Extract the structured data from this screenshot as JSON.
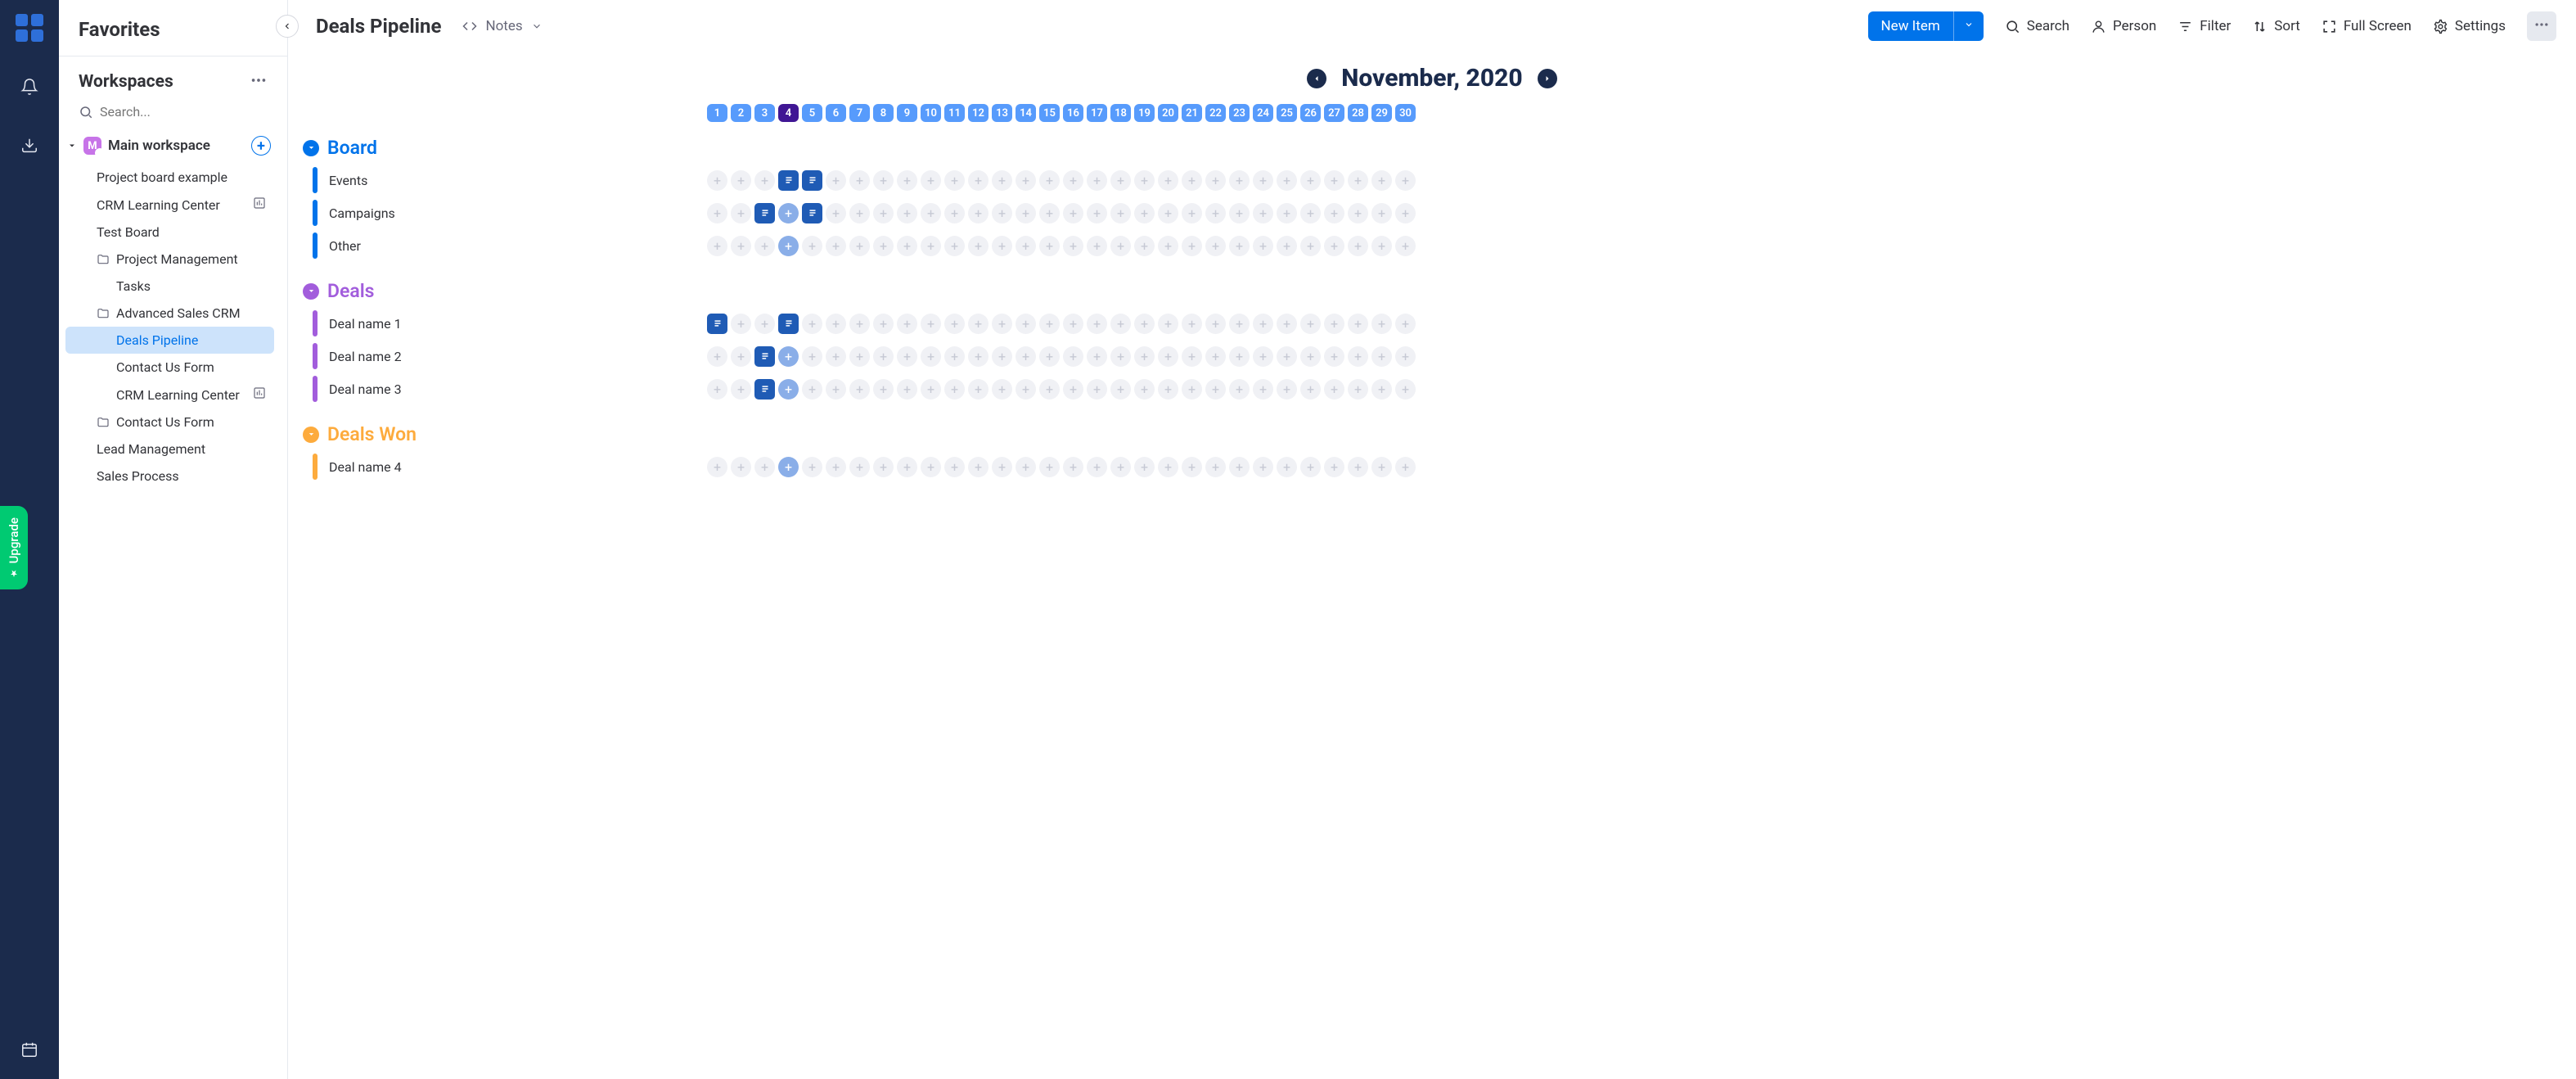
{
  "rail": {
    "upgrade": "Upgrade"
  },
  "sidebar": {
    "favorites": "Favorites",
    "workspaces": "Workspaces",
    "search_placeholder": "Search...",
    "main_workspace": "Main workspace",
    "ws_badge": "M",
    "tree": [
      {
        "label": "Project board example",
        "indent": 20,
        "icon": ""
      },
      {
        "label": "CRM Learning Center",
        "indent": 20,
        "icon": "",
        "right": "chart"
      },
      {
        "label": "Test Board",
        "indent": 20,
        "icon": ""
      },
      {
        "label": "Project Management",
        "indent": 20,
        "icon": "folder"
      },
      {
        "label": "Tasks",
        "indent": 44,
        "icon": ""
      },
      {
        "label": "Advanced Sales CRM",
        "indent": 20,
        "icon": "folder"
      },
      {
        "label": "Deals Pipeline",
        "indent": 44,
        "icon": "",
        "active": true
      },
      {
        "label": "Contact Us Form",
        "indent": 44,
        "icon": ""
      },
      {
        "label": "CRM Learning Center",
        "indent": 44,
        "icon": "",
        "right": "chart"
      },
      {
        "label": "Contact Us Form",
        "indent": 20,
        "icon": "folder"
      },
      {
        "label": "Lead Management",
        "indent": 20,
        "icon": ""
      },
      {
        "label": "Sales Process",
        "indent": 20,
        "icon": ""
      }
    ]
  },
  "topbar": {
    "title": "Deals Pipeline",
    "notes": "Notes",
    "new_item": "New Item",
    "search": "Search",
    "person": "Person",
    "filter": "Filter",
    "sort": "Sort",
    "full_screen": "Full Screen",
    "settings": "Settings"
  },
  "calendar": {
    "month": "November, 2020",
    "days": [
      1,
      2,
      3,
      4,
      5,
      6,
      7,
      8,
      9,
      10,
      11,
      12,
      13,
      14,
      15,
      16,
      17,
      18,
      19,
      20,
      21,
      22,
      23,
      24,
      25,
      26,
      27,
      28,
      29,
      30
    ],
    "selected": 4
  },
  "groups": [
    {
      "name": "Board",
      "color": "#0073ea",
      "items": [
        {
          "label": "Events",
          "cells": [
            "",
            "",
            "",
            "card",
            "card",
            "",
            "",
            "",
            "",
            "",
            "",
            "",
            "",
            "",
            "",
            "",
            "",
            "",
            "",
            "",
            "",
            "",
            "",
            "",
            "",
            "",
            "",
            "",
            "",
            ""
          ]
        },
        {
          "label": "Campaigns",
          "cells": [
            "",
            "",
            "card",
            "hole",
            "card",
            "",
            "",
            "",
            "",
            "",
            "",
            "",
            "",
            "",
            "",
            "",
            "",
            "",
            "",
            "",
            "",
            "",
            "",
            "",
            "",
            "",
            "",
            "",
            "",
            ""
          ]
        },
        {
          "label": "Other",
          "cells": [
            "",
            "",
            "",
            "hole",
            "",
            "",
            "",
            "",
            "",
            "",
            "",
            "",
            "",
            "",
            "",
            "",
            "",
            "",
            "",
            "",
            "",
            "",
            "",
            "",
            "",
            "",
            "",
            "",
            "",
            ""
          ]
        }
      ]
    },
    {
      "name": "Deals",
      "color": "#a25ddc",
      "items": [
        {
          "label": "Deal name 1",
          "cells": [
            "card",
            "",
            "",
            "card",
            "",
            "",
            "",
            "",
            "",
            "",
            "",
            "",
            "",
            "",
            "",
            "",
            "",
            "",
            "",
            "",
            "",
            "",
            "",
            "",
            "",
            "",
            "",
            "",
            "",
            ""
          ]
        },
        {
          "label": "Deal name 2",
          "cells": [
            "",
            "",
            "card",
            "hole",
            "",
            "",
            "",
            "",
            "",
            "",
            "",
            "",
            "",
            "",
            "",
            "",
            "",
            "",
            "",
            "",
            "",
            "",
            "",
            "",
            "",
            "",
            "",
            "",
            "",
            ""
          ]
        },
        {
          "label": "Deal name 3",
          "cells": [
            "",
            "",
            "card",
            "hole",
            "",
            "",
            "",
            "",
            "",
            "",
            "",
            "",
            "",
            "",
            "",
            "",
            "",
            "",
            "",
            "",
            "",
            "",
            "",
            "",
            "",
            "",
            "",
            "",
            "",
            ""
          ]
        }
      ]
    },
    {
      "name": "Deals Won",
      "color": "#fdab3d",
      "items": [
        {
          "label": "Deal name 4",
          "cells": [
            "",
            "",
            "",
            "hole",
            "",
            "",
            "",
            "",
            "",
            "",
            "",
            "",
            "",
            "",
            "",
            "",
            "",
            "",
            "",
            "",
            "",
            "",
            "",
            "",
            "",
            "",
            "",
            "",
            "",
            ""
          ]
        }
      ]
    }
  ]
}
